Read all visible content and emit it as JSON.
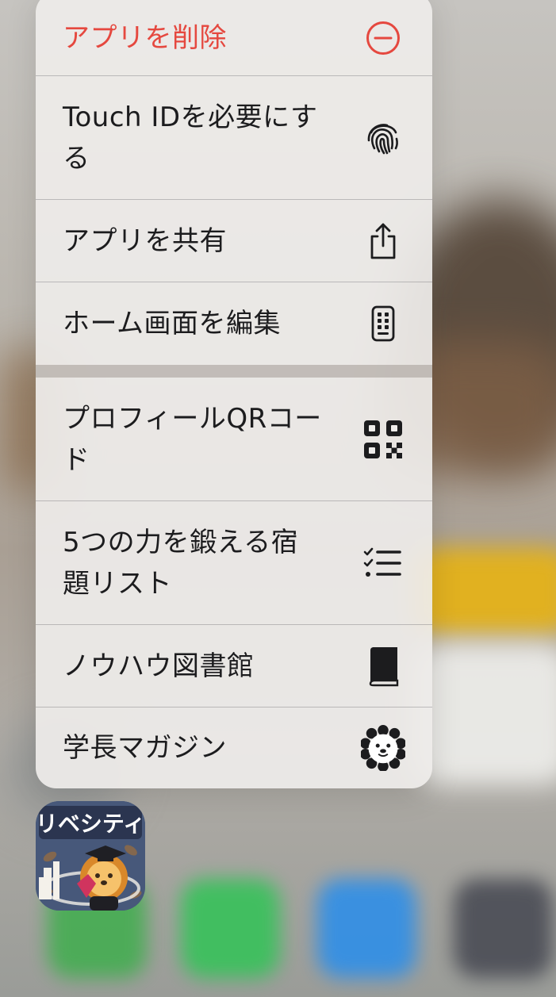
{
  "menu": {
    "items": [
      {
        "label": "アプリを削除",
        "icon": "minus-circle-icon",
        "role": "danger"
      },
      {
        "label": "Touch IDを必要にする",
        "icon": "fingerprint-icon"
      },
      {
        "label": "アプリを共有",
        "icon": "share-icon"
      },
      {
        "label": "ホーム画面を編集",
        "icon": "phone-edit-icon"
      },
      {
        "label": "プロフィールQRコード",
        "icon": "qr-code-icon"
      },
      {
        "label": "5つの力を鍛える宿題リスト",
        "icon": "checklist-icon"
      },
      {
        "label": "ノウハウ図書館",
        "icon": "book-icon"
      },
      {
        "label": "学長マガジン",
        "icon": "lion-icon"
      }
    ]
  },
  "app_icon": {
    "name": "リベシティ",
    "icon": "libecity-app-icon"
  },
  "colors": {
    "danger": "#e5483f",
    "text": "#1c1c1e",
    "menu_bg": "#eeeceA",
    "app_icon_bg": "#4a5a78",
    "lion": "#f0a93b"
  }
}
